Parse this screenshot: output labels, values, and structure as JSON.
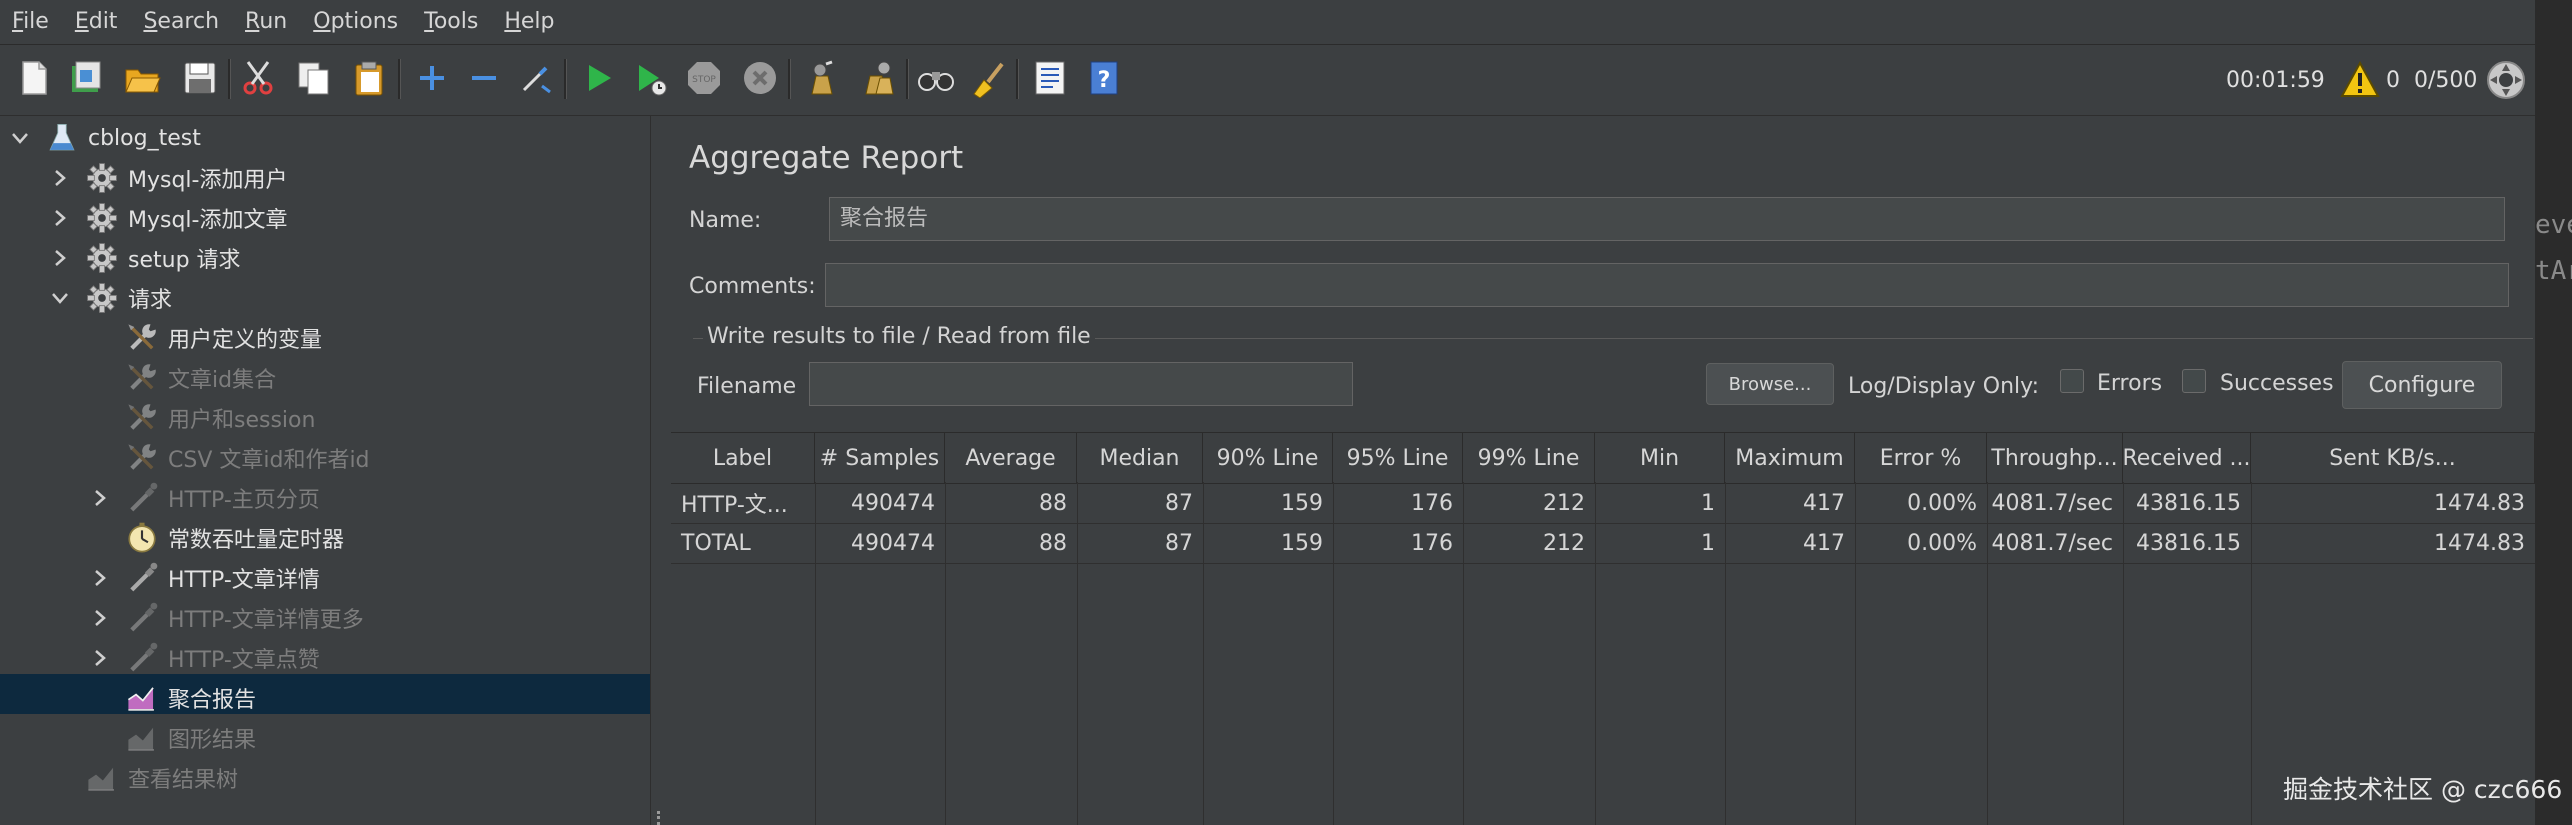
{
  "menu": [
    {
      "first": "F",
      "rest": "ile"
    },
    {
      "first": "E",
      "rest": "dit"
    },
    {
      "first": "S",
      "rest": "earch"
    },
    {
      "first": "R",
      "rest": "un"
    },
    {
      "first": "O",
      "rest": "ptions"
    },
    {
      "first": "T",
      "rest": "ools"
    },
    {
      "first": "H",
      "rest": "elp"
    }
  ],
  "toolbar": {
    "icons": [
      "new-icon",
      "templates-icon",
      "open-icon",
      "save-icon",
      "cut-icon",
      "copy-icon",
      "paste-icon",
      "expand-icon",
      "collapse-icon",
      "toggle-icon",
      "start-icon",
      "start-no-timers-icon",
      "stop-icon",
      "shutdown-icon",
      "clear-icon",
      "clear-all-icon",
      "search-icon",
      "reset-search-icon",
      "function-helper-icon",
      "help-icon"
    ],
    "timer": "00:01:59",
    "warnings": "0",
    "threads": "0/500"
  },
  "tree": [
    {
      "label": "cblog_test",
      "icon": "test-plan-icon",
      "arrow": "down",
      "enabled": true
    },
    {
      "label": "Mysql-添加用户",
      "icon": "gear-icon",
      "arrow": "right",
      "enabled": true
    },
    {
      "label": "Mysql-添加文章",
      "icon": "gear-icon",
      "arrow": "right",
      "enabled": true
    },
    {
      "label": "setup 请求",
      "icon": "gear-icon",
      "arrow": "right",
      "enabled": true
    },
    {
      "label": "请求",
      "icon": "gear-icon",
      "arrow": "down",
      "enabled": true
    },
    {
      "label": "用户定义的变量",
      "icon": "wrench-icon",
      "arrow": "",
      "enabled": true
    },
    {
      "label": "文章id集合",
      "icon": "wrench-icon",
      "arrow": "",
      "enabled": false
    },
    {
      "label": "用户和session",
      "icon": "wrench-icon",
      "arrow": "",
      "enabled": false
    },
    {
      "label": "CSV 文章id和作者id",
      "icon": "wrench-icon",
      "arrow": "",
      "enabled": false
    },
    {
      "label": "HTTP-主页分页",
      "icon": "pipette-icon",
      "arrow": "right",
      "enabled": false
    },
    {
      "label": "常数吞吐量定时器",
      "icon": "timer-icon",
      "arrow": "",
      "enabled": true
    },
    {
      "label": "HTTP-文章详情",
      "icon": "pipette-icon",
      "arrow": "right",
      "enabled": true
    },
    {
      "label": "HTTP-文章详情更多",
      "icon": "pipette-icon",
      "arrow": "right",
      "enabled": false
    },
    {
      "label": "HTTP-文章点赞",
      "icon": "pipette-icon",
      "arrow": "right",
      "enabled": false
    },
    {
      "label": "聚合报告",
      "icon": "report-icon",
      "arrow": "",
      "enabled": true
    },
    {
      "label": "图形结果",
      "icon": "graph-icon",
      "arrow": "",
      "enabled": false
    },
    {
      "label": "查看结果树",
      "icon": "graph-icon",
      "arrow": "",
      "enabled": false
    }
  ],
  "panel": {
    "title": "Aggregate Report",
    "name_label": "Name:",
    "name_value": "聚合报告",
    "comments_label": "Comments:",
    "comments_value": "",
    "group_title": "Write results to file / Read from file",
    "filename_label": "Filename",
    "filename_value": "",
    "browse": "Browse...",
    "log_display": "Log/Display Only:",
    "errors": "Errors",
    "successes": "Successes",
    "configure": "Configure"
  },
  "table": {
    "headers": [
      "Label",
      "# Samples",
      "Average",
      "Median",
      "90% Line",
      "95% Line",
      "99% Line",
      "Min",
      "Maximum",
      "Error %",
      "Throughp...",
      "Received ...",
      "Sent KB/s..."
    ],
    "rows": [
      [
        "HTTP-文...",
        "490474",
        "88",
        "87",
        "159",
        "176",
        "212",
        "1",
        "417",
        "0.00%",
        "4081.7/sec",
        "43816.15",
        "1474.83"
      ],
      [
        "TOTAL",
        "490474",
        "88",
        "87",
        "159",
        "176",
        "212",
        "1",
        "417",
        "0.00%",
        "4081.7/sec",
        "43816.15",
        "1474.83"
      ]
    ]
  },
  "right_strip": {
    "line1": "eve",
    "line2": "tAr"
  },
  "watermark": "掘金技术社区 @ czc666"
}
